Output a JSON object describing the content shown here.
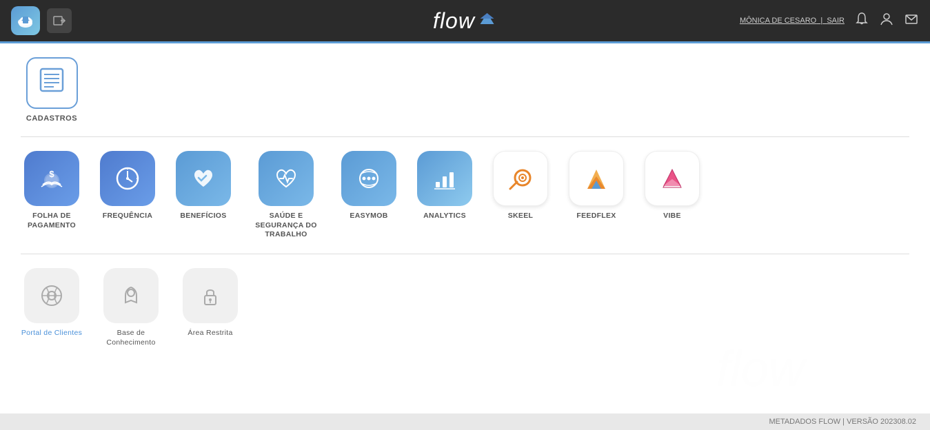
{
  "header": {
    "logo_text": "flow",
    "user_name": "MÔNICA DE CESARO",
    "user_separator": "|",
    "logout_label": "SAIR"
  },
  "cadastros_section": {
    "label": "CADASTROS"
  },
  "apps_row1": [
    {
      "id": "folha",
      "label": "FOLHA DE\nPAGAMENTO",
      "label_line1": "FOLHA DE",
      "label_line2": "PAGAMENTO",
      "color_class": "app-folha"
    },
    {
      "id": "frequencia",
      "label": "FREQUÊNCIA",
      "color_class": "app-frequencia"
    },
    {
      "id": "beneficios",
      "label": "BENEFÍCIOS",
      "color_class": "app-beneficios"
    },
    {
      "id": "saude",
      "label": "SAÚDE E\nSEGURANÇA DO\nTRABALHO",
      "label_line1": "SAÚDE E",
      "label_line2": "SEGURANÇA DO",
      "label_line3": "TRABALHO",
      "color_class": "app-saude"
    },
    {
      "id": "easymob",
      "label": "EASYMOB",
      "color_class": "app-easymob"
    },
    {
      "id": "analytics",
      "label": "ANALYTICS",
      "color_class": "app-analytics"
    },
    {
      "id": "skeel",
      "label": "SKEEL",
      "color_class": "app-skeel"
    },
    {
      "id": "feedflex",
      "label": "FEEDFLEX",
      "color_class": "app-feedflex"
    },
    {
      "id": "vibe",
      "label": "VIBE",
      "color_class": "app-vibe"
    }
  ],
  "apps_row2": [
    {
      "id": "portal",
      "label": "Portal de Clientes"
    },
    {
      "id": "base",
      "label": "Base de\nConhecimento",
      "label_line1": "Base de",
      "label_line2": "Conhecimento"
    },
    {
      "id": "area",
      "label": "Área Restrita"
    }
  ],
  "footer": {
    "text": "METADADOS FLOW | VERSÃO 202308.02"
  }
}
